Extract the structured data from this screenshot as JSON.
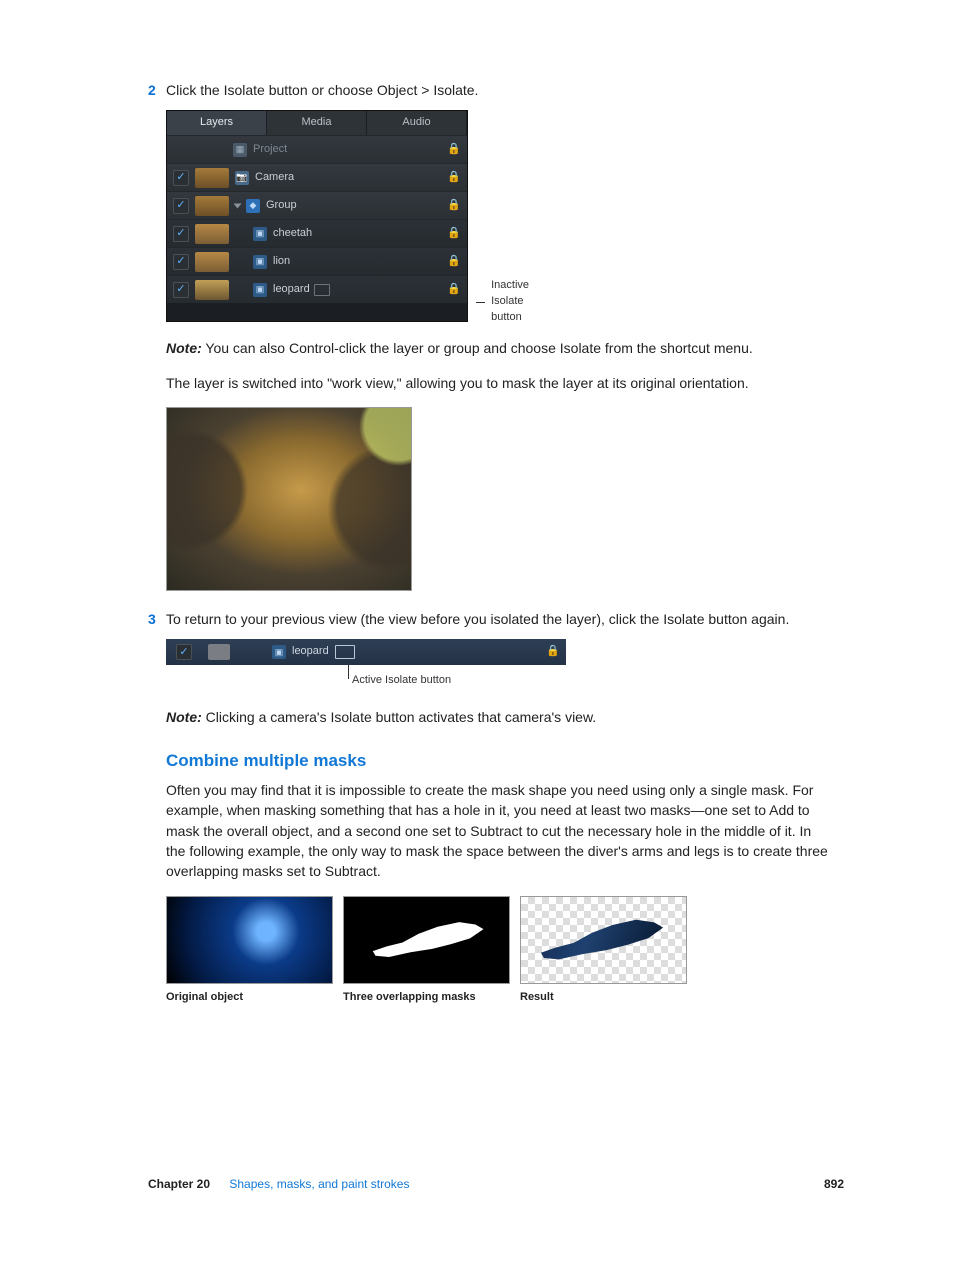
{
  "steps": {
    "s2_num": "2",
    "s2_text": "Click the Isolate button or choose Object > Isolate.",
    "s3_num": "3",
    "s3_text": "To return to your previous view (the view before you isolated the layer), click the Isolate button again."
  },
  "panel": {
    "tabs": {
      "layers": "Layers",
      "media": "Media",
      "audio": "Audio"
    },
    "rows": {
      "project": "Project",
      "camera": "Camera",
      "group": "Group",
      "cheetah": "cheetah",
      "lion": "lion",
      "leopard": "leopard"
    }
  },
  "callouts": {
    "inactive": "Inactive Isolate button",
    "active": "Active Isolate button"
  },
  "notes": {
    "label1": "Note:",
    "n1": "  You can also Control-click the layer or group and choose Isolate from the shortcut menu.",
    "label2": "Note:",
    "n2": "  Clicking a camera's Isolate button activates that camera's view."
  },
  "paragraphs": {
    "workview": "The layer is switched into \"work view,\" allowing you to mask the layer at its original orientation.",
    "combine_title": "Combine multiple masks",
    "combine_body": "Often you may find that it is impossible to create the mask shape you need using only a single mask. For example, when masking something that has a hole in it, you need at least two masks—one set to Add to mask the overall object, and a second one set to Subtract to cut the necessary hole in the middle of it. In the following example, the only way to mask the space between the diver's arms and legs is to create three overlapping masks set to Subtract."
  },
  "panel2": {
    "label": "leopard"
  },
  "triptych": {
    "a": "Original object",
    "b": "Three overlapping masks",
    "c": "Result"
  },
  "footer": {
    "chapter": "Chapter 20",
    "title": "Shapes, masks, and paint strokes",
    "page": "892"
  }
}
